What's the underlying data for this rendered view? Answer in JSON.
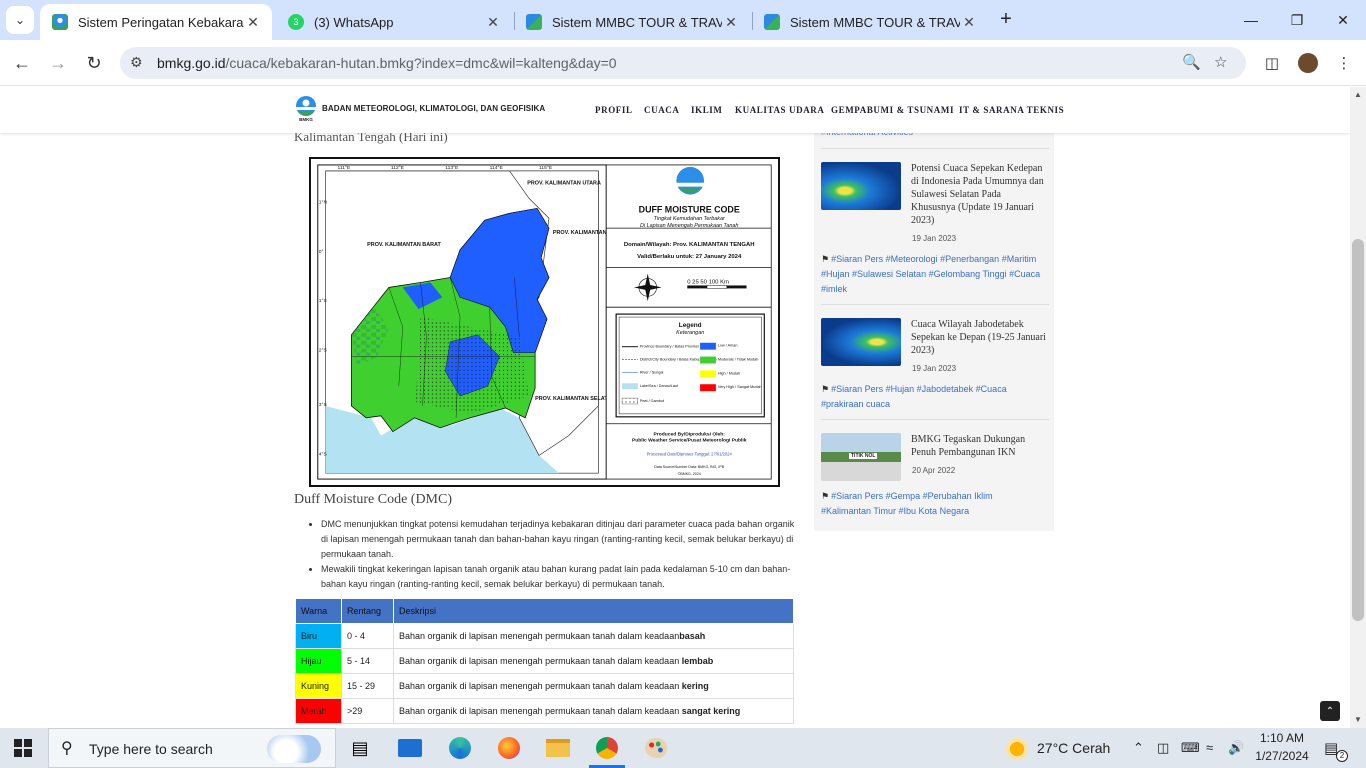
{
  "browser": {
    "tabs": [
      {
        "title": "Sistem Peringatan Kebakaran H",
        "active": true,
        "favicon": "bmkg-icon"
      },
      {
        "title": "(3) WhatsApp",
        "active": false,
        "favicon": "whatsapp-icon"
      },
      {
        "title": "Sistem MMBC TOUR & TRAVEL",
        "active": false,
        "favicon": "site-icon"
      },
      {
        "title": "Sistem MMBC TOUR & TRAVEL",
        "active": false,
        "favicon": "site-icon"
      }
    ],
    "url_domain": "bmkg.go.id",
    "url_path": "/cuaca/kebakaran-hutan.bmkg?index=dmc&wil=kalteng&day=0"
  },
  "site": {
    "logo_text": "BMKG",
    "org_name": "BADAN METEOROLOGI, KLIMATOLOGI, DAN GEOFISIKA",
    "nav": [
      "PROFIL",
      "CUACA",
      "IKLIM",
      "KUALITAS UDARA",
      "GEMPABUMI & TSUNAMI",
      "IT & SARANA TEKNIS"
    ]
  },
  "article": {
    "region_heading": "Kalimantan Tengah (Hari ini)",
    "map": {
      "title": "DUFF MOISTURE CODE",
      "subtitle_1": "Tingkat Kemudahan Terbakar",
      "subtitle_2": "Di Lapisan Menengah Permukaan Tanah",
      "domain_line": "Domain/Wilayah: Prov. KALIMANTAN TENGAH",
      "valid_line": "Valid/Berlaku untuk: 27 January 2024",
      "scale": "0  25 50     100 Km",
      "legend_title": "Legend",
      "legend_subtitle": "Keterangan",
      "legend_left": [
        "Province Boundary / Batas Provinsi",
        "District/City Boundary / Batas Kabupaten/Kota",
        "River / Sungai",
        "Lake/Sea / Danau/Laut",
        "Peat / Gambut"
      ],
      "legend_right": [
        "Low / Aman",
        "Moderate / Tidak Mudah",
        "High / Mudah",
        "Very High / Sangat Mudah"
      ],
      "produced_1": "Produced By/Diproduksi Oleh:",
      "produced_2": "Public Weather Service/Pusat Meteorologi Publik",
      "processed": "Processed Date/Diproses Tanggal: 27/01/2024",
      "source": "Data Source/Sumber Data: BMKG, BIG, IPB",
      "copyright": "©BMKG, 2024",
      "labels": {
        "kaltara": "PROV. KALIMANTAN UTARA",
        "kalbar": "PROV. KALIMANTAN BARAT",
        "kaltim": "PROV. KALIMANTAN TIMUR",
        "kalsel": "PROV. KALIMANTAN SELATAN"
      },
      "lon_ticks": [
        "111°E",
        "112°E",
        "113°E",
        "114°E",
        "115°E"
      ],
      "lat_ticks": [
        "1°N",
        "0°",
        "1°S",
        "2°S",
        "3°S",
        "4°S"
      ],
      "colors": {
        "low": "#1f5fff",
        "moderate": "#3fcf2f",
        "high": "#ffff00",
        "very_high": "#ff0000",
        "sea": "#b3e3f3"
      }
    },
    "dmc_heading": "Duff Moisture Code (DMC)",
    "bullets": [
      "DMC menunjukkan tingkat potensi kemudahan terjadinya kebakaran ditinjau dari parameter cuaca pada bahan organik di lapisan menengah permukaan tanah dan bahan-bahan kayu ringan (ranting-ranting kecil, semak belukar berkayu) di permukaan tanah.",
      "Mewakili tingkat kekeringan lapisan tanah organik atau bahan kurang padat lain pada kedalaman 5-10 cm dan bahan-bahan kayu ringan (ranting-ranting kecil, semak belukar berkayu) di permukaan tanah."
    ],
    "table": {
      "headers": [
        "Warna",
        "Rentang",
        "Deskripsi"
      ],
      "rows": [
        {
          "color_name": "Biru",
          "hex": "#00b0f0",
          "range": "0 - 4",
          "desc": "Bahan organik di lapisan menengah permukaan tanah dalam keadaan",
          "strong": "basah",
          "joined": true
        },
        {
          "color_name": "Hijau",
          "hex": "#00ff00",
          "range": "5 - 14",
          "desc": "Bahan organik di lapisan menengah permukaan tanah dalam keadaan ",
          "strong": "lembab",
          "joined": false
        },
        {
          "color_name": "Kuning",
          "hex": "#ffff00",
          "range": "15 - 29",
          "desc": "Bahan organik di lapisan menengah permukaan tanah dalam keadaan ",
          "strong": "kering",
          "joined": false
        },
        {
          "color_name": "Merah",
          "hex": "#ff0000",
          "range": ">29",
          "desc": "Bahan organik di lapisan menengah permukaan tanah dalam keadaan ",
          "strong": "sangat kering",
          "joined": false
        }
      ]
    }
  },
  "sidebar": {
    "top_tag": "#International Activities",
    "items": [
      {
        "title": "Potensi Cuaca Sepekan Kedepan di Indonesia Pada Umumnya dan Sulawesi Selatan Pada Khususnya (Update 19 Januari 2023)",
        "date": "19 Jan 2023",
        "tags": "#Siaran Pers #Meteorologi #Penerbangan #Maritim #Hujan #Sulawesi Selatan #Gelombang Tinggi #Cuaca #imlek"
      },
      {
        "title": "Cuaca Wilayah Jabodetabek Sepekan ke Depan (19-25 Januari 2023)",
        "date": "19 Jan 2023",
        "tags": "#Siaran Pers #Hujan #Jabodetabek #Cuaca #prakiraan cuaca"
      },
      {
        "title": "BMKG Tegaskan Dukungan Penuh Pembangunan IKN",
        "date": "20 Apr 2022",
        "tags": "#Siaran Pers #Gempa #Perubahan Iklim #Kalimantan Timur #Ibu Kota Negara",
        "banner": "TITIK NOL"
      }
    ]
  },
  "taskbar": {
    "search_placeholder": "Type here to search",
    "weather": "27°C  Cerah",
    "time": "1:10 AM",
    "date": "1/27/2024",
    "notifications": "2"
  }
}
